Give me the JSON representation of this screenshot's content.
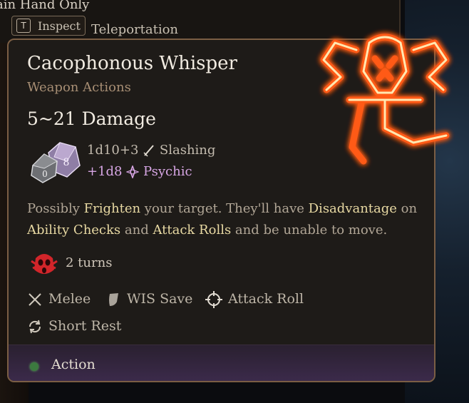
{
  "background": {
    "top_text": "ain Hand Only",
    "inspect_key": "T",
    "inspect_label": "Inspect",
    "teleport_label": "Teleportation"
  },
  "tooltip": {
    "title": "Cacophonous Whisper",
    "subtitle": "Weapon Actions",
    "damage": "5~21 Damage",
    "dice_labels": {
      "d10": "0",
      "d8": "8"
    },
    "primary_roll": "1d10+3",
    "primary_type": "Slashing",
    "bonus_roll": "+1d8",
    "bonus_type": "Psychic",
    "description": {
      "p1": "Possibly ",
      "h1": "Frighten",
      "p2": " your target. They'll have ",
      "h2": "Disadvantage",
      "p3": " on ",
      "h3": "Ability Checks",
      "p4": " and ",
      "h4": "Attack Rolls",
      "p5": " and be unable to move."
    },
    "condition_duration": "2 turns",
    "properties": {
      "range": "Melee",
      "save": "WIS Save",
      "roll": "Attack Roll",
      "recharge": "Short Rest"
    },
    "cost": "Action"
  },
  "colors": {
    "title": "#f1ebe1",
    "subtitle": "#a78e74",
    "highlight": "#e8d9a3",
    "psychic": "#d7a6e4",
    "sigil_glow": "#ff6a1a",
    "action_dot": "#3c7a3f"
  },
  "icons": {
    "dice": "dice-d10-d8-icon",
    "slashing": "sword-icon",
    "psychic": "psychic-icon",
    "condition": "frightened-skull-icon",
    "melee": "crossed-swords-icon",
    "save": "shield-icon",
    "attack_roll": "crosshair-icon",
    "recharge": "cycle-arrows-icon",
    "action": "action-dot-icon",
    "sigil": "cacophonous-whisper-sigil-icon"
  }
}
